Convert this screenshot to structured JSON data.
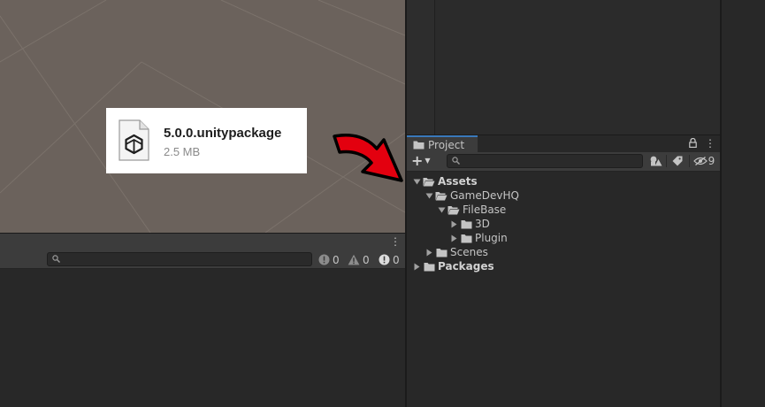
{
  "package_file": {
    "name": "5.0.0.unitypackage",
    "size": "2.5 MB",
    "icon": "unity-package-file-icon"
  },
  "console": {
    "search_placeholder": "",
    "log_count": "0",
    "warning_count": "0",
    "error_count": "0"
  },
  "project": {
    "tab_label": "Project",
    "search_placeholder": "",
    "hidden_packages_count": "9",
    "tree": [
      {
        "label": "Assets",
        "level": 0,
        "expanded": true,
        "bold": true
      },
      {
        "label": "GameDevHQ",
        "level": 1,
        "expanded": true,
        "bold": false
      },
      {
        "label": "FileBase",
        "level": 2,
        "expanded": true,
        "bold": false
      },
      {
        "label": "3D",
        "level": 3,
        "expanded": false,
        "bold": false
      },
      {
        "label": "Plugin",
        "level": 3,
        "expanded": false,
        "bold": false
      },
      {
        "label": "Scenes",
        "level": 1,
        "expanded": false,
        "bold": false
      },
      {
        "label": "Packages",
        "level": 0,
        "expanded": false,
        "bold": true
      }
    ]
  },
  "colors": {
    "scene_bg": "#6b625c",
    "panel_bg": "#282828",
    "toolbar_bg": "#3c3c3c",
    "tab_accent": "#3a79bb",
    "arrow_red": "#e3000f"
  }
}
